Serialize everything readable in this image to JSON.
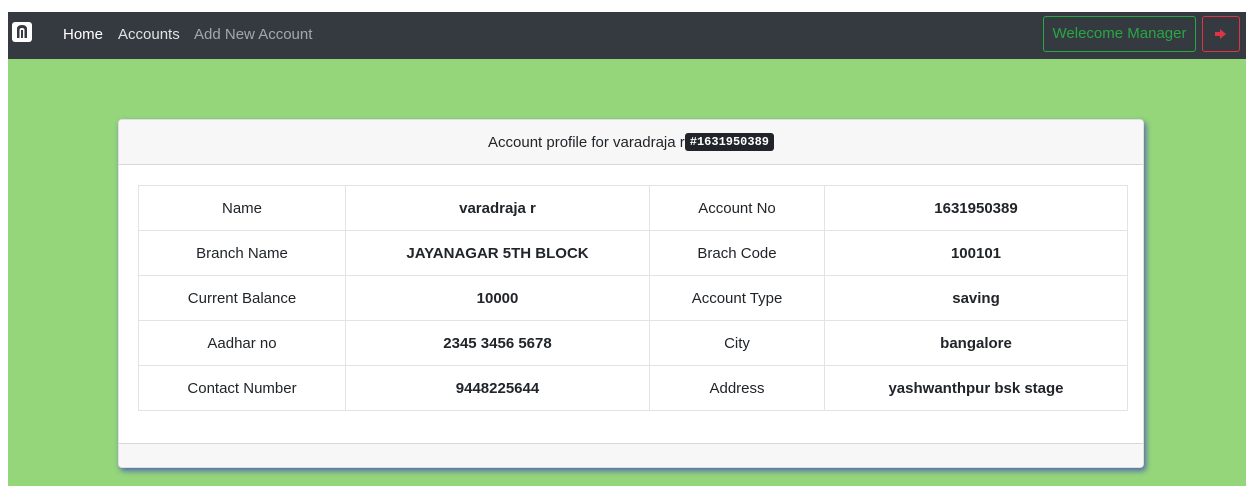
{
  "navbar": {
    "brand_icon": "bank-logo-icon",
    "links": [
      {
        "label": "Home"
      },
      {
        "label": "Accounts"
      },
      {
        "label": "Add New Account"
      }
    ],
    "welcome_label": "Welecome Manager",
    "logout_icon": "sign-out-icon"
  },
  "card": {
    "header_text": "Account profile for varadraja r",
    "header_badge": "#1631950389",
    "rows": [
      {
        "label1": "Name",
        "value1": "varadraja r",
        "label2": "Account No",
        "value2": "1631950389"
      },
      {
        "label1": "Branch Name",
        "value1": "JAYANAGAR 5TH BLOCK",
        "label2": "Brach Code",
        "value2": "100101"
      },
      {
        "label1": "Current Balance",
        "value1": "10000",
        "label2": "Account Type",
        "value2": "saving"
      },
      {
        "label1": "Aadhar no",
        "value1": "2345 3456 5678",
        "label2": "City",
        "value2": "bangalore"
      },
      {
        "label1": "Contact Number",
        "value1": "9448225644",
        "label2": "Address",
        "value2": "yashwanthpur bsk stage"
      }
    ]
  },
  "colors": {
    "page_bg": "#95d67b",
    "navbar_bg": "#343a40",
    "welcome_green": "#28a745",
    "logout_red": "#dc3545",
    "card_shadow": "#3c46be"
  }
}
